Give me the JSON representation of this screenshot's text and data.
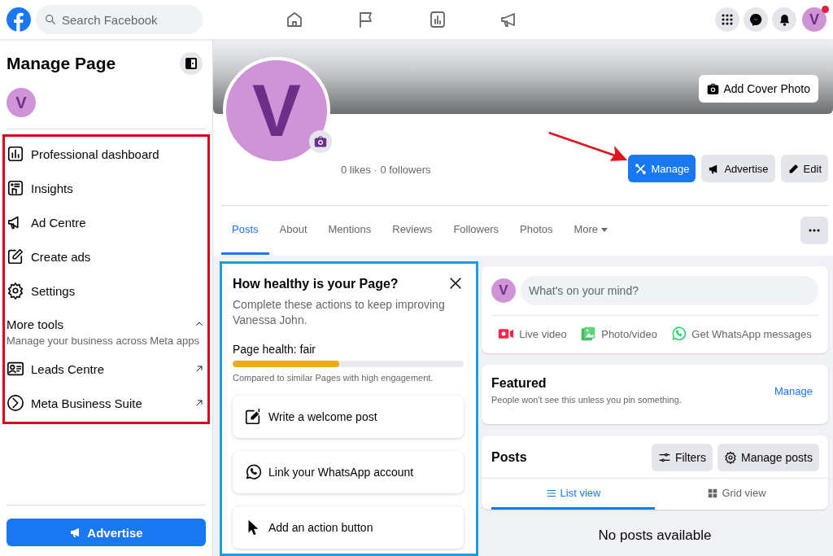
{
  "topbar": {
    "search": {
      "placeholder": "Search Facebook"
    },
    "account": {
      "initial": "V",
      "has_notification": true
    }
  },
  "sidebar": {
    "title": "Manage Page",
    "page_initial": "V",
    "items": [
      {
        "label": "Professional dashboard",
        "kind": "dashboard"
      },
      {
        "label": "Insights",
        "kind": "insights"
      },
      {
        "label": "Ad Centre",
        "kind": "megaphone"
      },
      {
        "label": "Create ads",
        "kind": "pencil"
      },
      {
        "label": "Settings",
        "kind": "gear"
      }
    ],
    "more_tools": {
      "title": "More tools",
      "subtitle": "Manage your business across Meta apps",
      "expanded": true,
      "items": [
        {
          "label": "Leads Centre",
          "kind": "leads"
        },
        {
          "label": "Meta Business Suite",
          "kind": "suite"
        }
      ]
    },
    "advertise_button": "Advertise"
  },
  "profile": {
    "initial": "V",
    "add_cover": "Add Cover Photo",
    "stats": "0 likes · 0 followers",
    "actions": [
      {
        "label": "Manage",
        "kind": "manage",
        "primary": true
      },
      {
        "label": "Advertise",
        "kind": "advertise",
        "primary": false
      },
      {
        "label": "Edit",
        "kind": "edit",
        "primary": false
      }
    ],
    "tabs": [
      {
        "label": "Posts",
        "selected": true
      },
      {
        "label": "About",
        "selected": false
      },
      {
        "label": "Mentions",
        "selected": false
      },
      {
        "label": "Reviews",
        "selected": false
      },
      {
        "label": "Followers",
        "selected": false
      },
      {
        "label": "Photos",
        "selected": false
      },
      {
        "label": "More",
        "selected": false
      }
    ]
  },
  "health": {
    "title": "How healthy is your Page?",
    "description": "Complete these actions to keep improving Vanessa John.",
    "status": "Page health: fair",
    "level": 0.46,
    "note": "Compared to similar Pages with high engagement.",
    "actions": [
      {
        "label": "Write a welcome post",
        "kind": "write"
      },
      {
        "label": "Link your WhatsApp account",
        "kind": "whatsapp"
      },
      {
        "label": "Add an action button",
        "kind": "cursor"
      }
    ]
  },
  "composer": {
    "initial": "V",
    "placeholder": "What's on your mind?",
    "actions": [
      {
        "label": "Live video",
        "kind": "live"
      },
      {
        "label": "Photo/video",
        "kind": "photo"
      },
      {
        "label": "Get WhatsApp messages",
        "kind": "whatsapp"
      }
    ]
  },
  "featured": {
    "title": "Featured",
    "subtitle": "People won't see this unless you pin something.",
    "link": "Manage"
  },
  "posts": {
    "title": "Posts",
    "buttons": [
      {
        "label": "Filters",
        "kind": "filters"
      },
      {
        "label": "Manage posts",
        "kind": "gear"
      }
    ],
    "views": [
      {
        "label": "List view",
        "kind": "list",
        "selected": true
      },
      {
        "label": "Grid view",
        "kind": "grid",
        "selected": false
      }
    ],
    "empty": "No posts available"
  }
}
